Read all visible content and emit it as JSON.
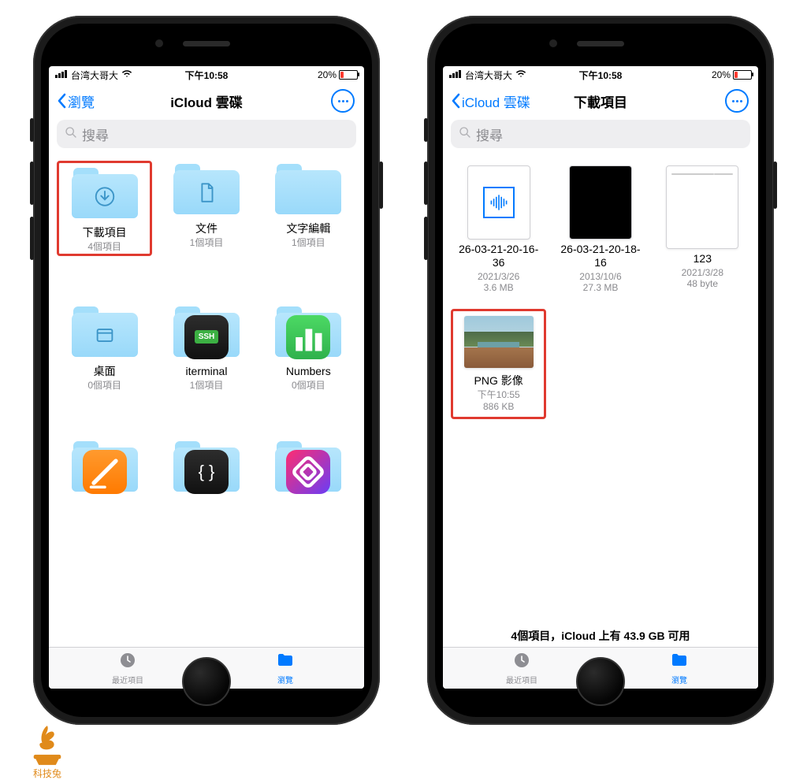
{
  "status": {
    "carrier": "台湾大哥大",
    "time": "下午10:58",
    "battery_pct": "20%"
  },
  "phone1": {
    "back": "瀏覽",
    "title": "iCloud 雲碟",
    "search_placeholder": "搜尋",
    "folders": [
      {
        "name": "下載項目",
        "meta": "4個項目",
        "icon": "download",
        "highlight": true
      },
      {
        "name": "文件",
        "meta": "1個項目",
        "icon": "doc"
      },
      {
        "name": "文字編輯",
        "meta": "1個項目",
        "icon": "textedit"
      },
      {
        "name": "桌面",
        "meta": "0個項目",
        "icon": "desktop"
      },
      {
        "name": "iterminal",
        "meta": "1個項目",
        "icon": "ssh"
      },
      {
        "name": "Numbers",
        "meta": "0個項目",
        "icon": "numbers"
      },
      {
        "name": "",
        "meta": "",
        "icon": "pages"
      },
      {
        "name": "",
        "meta": "",
        "icon": "code"
      },
      {
        "name": "",
        "meta": "",
        "icon": "shortcuts"
      }
    ]
  },
  "phone2": {
    "back": "iCloud 雲碟",
    "title": "下載項目",
    "search_placeholder": "搜尋",
    "files": [
      {
        "name": "26-03-21-20-16-36",
        "date": "2021/3/26",
        "size": "3.6 MB",
        "type": "audio"
      },
      {
        "name": "26-03-21-20-18-16",
        "date": "2013/10/6",
        "size": "27.3 MB",
        "type": "video"
      },
      {
        "name": "123",
        "date": "2021/3/28",
        "size": "48 byte",
        "type": "txt"
      },
      {
        "name": "PNG 影像",
        "date": "下午10:55",
        "size": "886 KB",
        "type": "image",
        "highlight": true
      }
    ],
    "summary": "4個項目，iCloud 上有 43.9 GB 可用"
  },
  "tabs": {
    "recent": "最近項目",
    "browse": "瀏覽"
  },
  "watermark": "科技兔"
}
